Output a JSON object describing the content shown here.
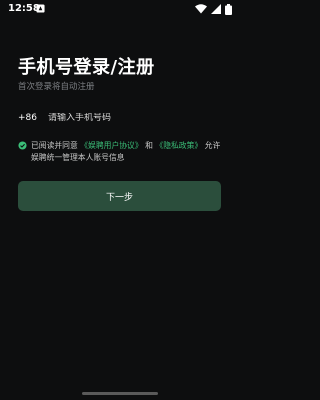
{
  "status_bar": {
    "time": "12:58",
    "notification_icon": "app-notification-icon",
    "wifi_icon": "wifi-icon",
    "signal_icon": "signal-icon",
    "battery_icon": "battery-icon"
  },
  "login": {
    "title": "手机号登录/注册",
    "subtitle": "首次登录将自动注册",
    "country_code": "+86",
    "phone_placeholder": "请输入手机号码",
    "agreement": {
      "prefix": "已阅读并同意",
      "user_agreement": "《娱聘用户协议》",
      "and": "和",
      "privacy_policy": "《隐私政策》",
      "suffix": "允许娱聘统一管理本人账号信息"
    },
    "next_button": "下一步"
  },
  "colors": {
    "background": "#0d0e0f",
    "accent_green": "#3bbf78",
    "button_bg": "#2b4e3c",
    "subtitle_gray": "#7c7f83"
  }
}
